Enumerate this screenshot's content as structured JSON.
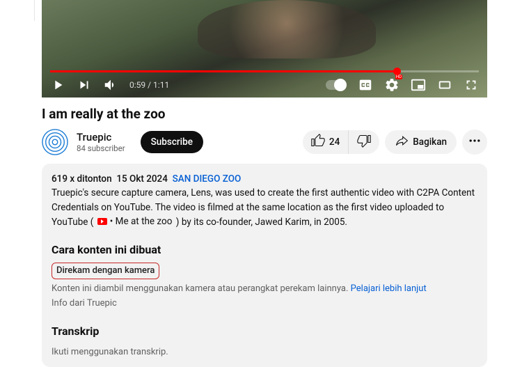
{
  "player": {
    "current_time": "0:59",
    "duration": "1:11"
  },
  "video": {
    "title": "I am really at the zoo"
  },
  "channel": {
    "name": "Truepic",
    "subscribers": "84 subscriber"
  },
  "subscribe_label": "Subscribe",
  "actions": {
    "like_count": "24",
    "share_label": "Bagikan"
  },
  "description": {
    "views": "619 x ditonton",
    "date": "15 Okt 2024",
    "tag": "SAN DIEGO ZOO",
    "body_before": "Truepic's secure capture camera, Lens, was used to create the first authentic video with C2PA Content Credentials on YouTube. The video is filmed at the same location as the first video uploaded to YouTube (",
    "chip_text": "• Me at the zoo",
    "body_after": ") by its co-founder, Jawed Karim, in 2005."
  },
  "content_made": {
    "heading": "Cara konten ini dibuat",
    "camera_label": "Direkam dengan kamera",
    "explain": "Konten ini diambil menggunakan kamera atau perangkat perekam lainnya.",
    "learn_more": "Pelajari lebih lanjut",
    "info_from": "Info dari Truepic"
  },
  "transcript": {
    "heading": "Transkrip",
    "sub": "Ikuti menggunakan transkrip."
  }
}
